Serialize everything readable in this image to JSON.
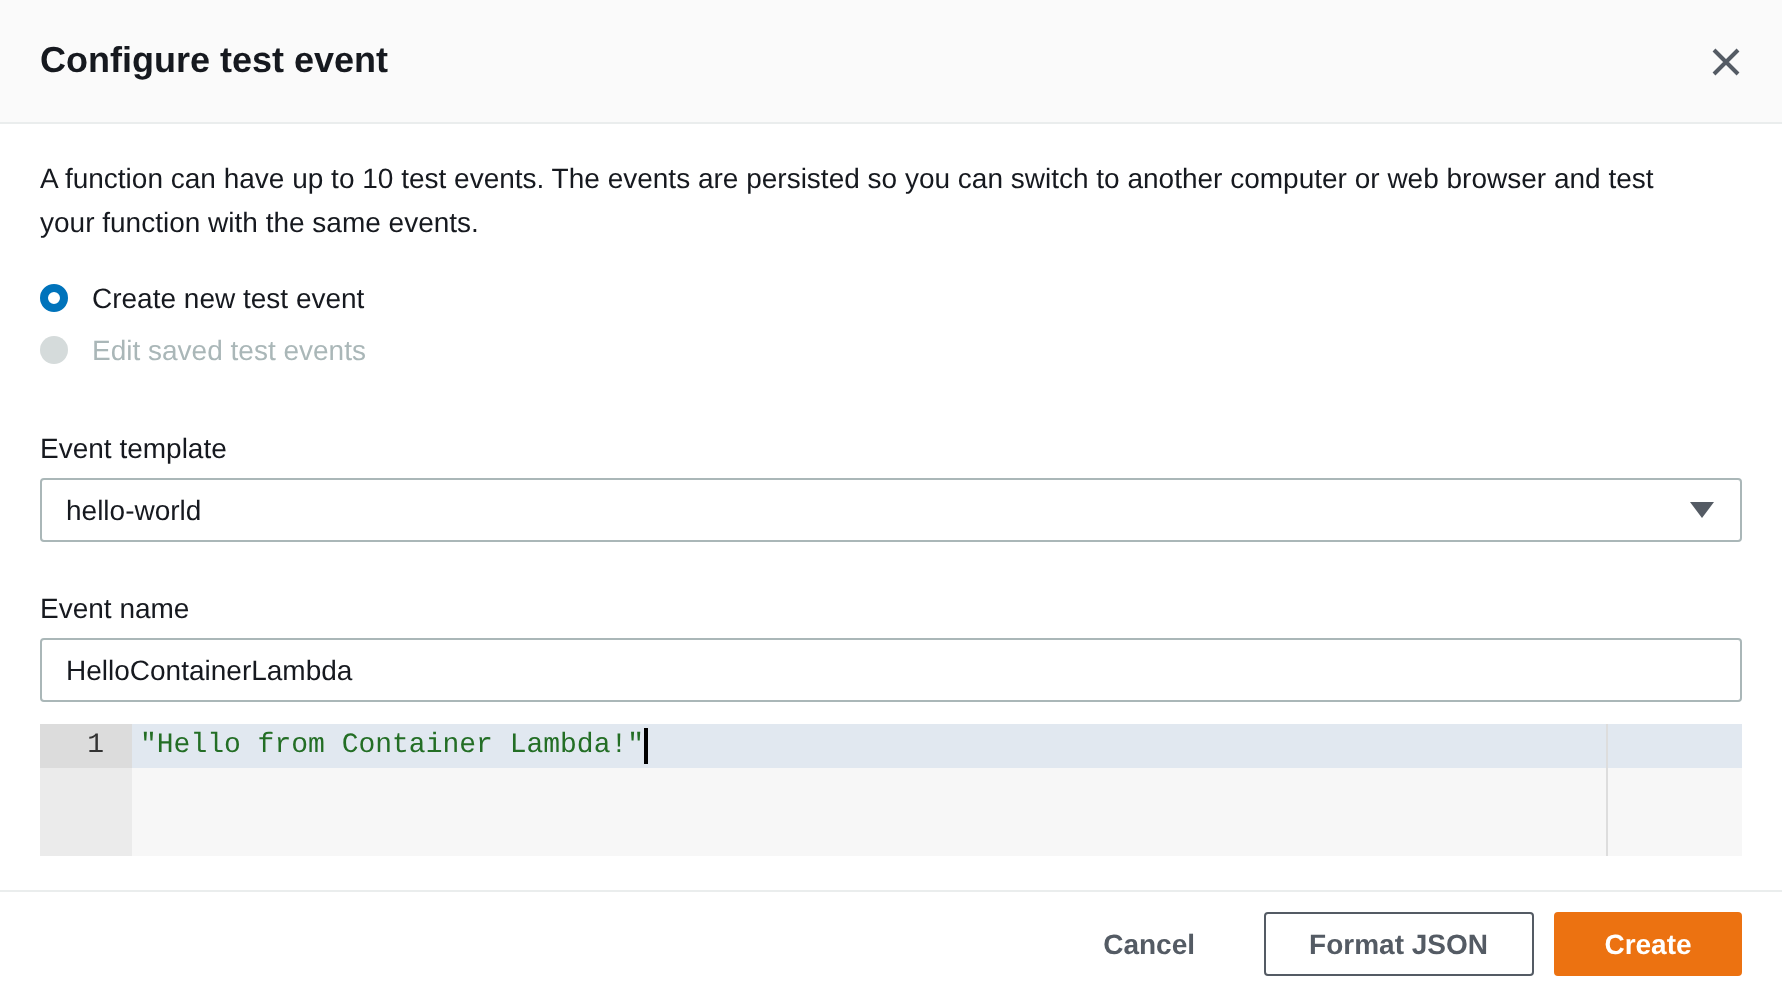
{
  "dialog": {
    "title": "Configure test event",
    "description": "A function can have up to 10 test events. The events are persisted so you can switch to another computer or web browser and test your function with the same events.",
    "options": [
      {
        "label": "Create new test event",
        "selected": true,
        "disabled": false
      },
      {
        "label": "Edit saved test events",
        "selected": false,
        "disabled": true
      }
    ],
    "event_template": {
      "label": "Event template",
      "value": "hello-world"
    },
    "event_name": {
      "label": "Event name",
      "value": "HelloContainerLambda"
    },
    "editor": {
      "lines": [
        {
          "number": "1",
          "code": "\"Hello from Container Lambda!\"",
          "active": true
        }
      ]
    },
    "buttons": [
      {
        "label": "Cancel",
        "kind": "link"
      },
      {
        "label": "Format JSON",
        "kind": "secondary"
      },
      {
        "label": "Create",
        "kind": "primary"
      }
    ]
  }
}
